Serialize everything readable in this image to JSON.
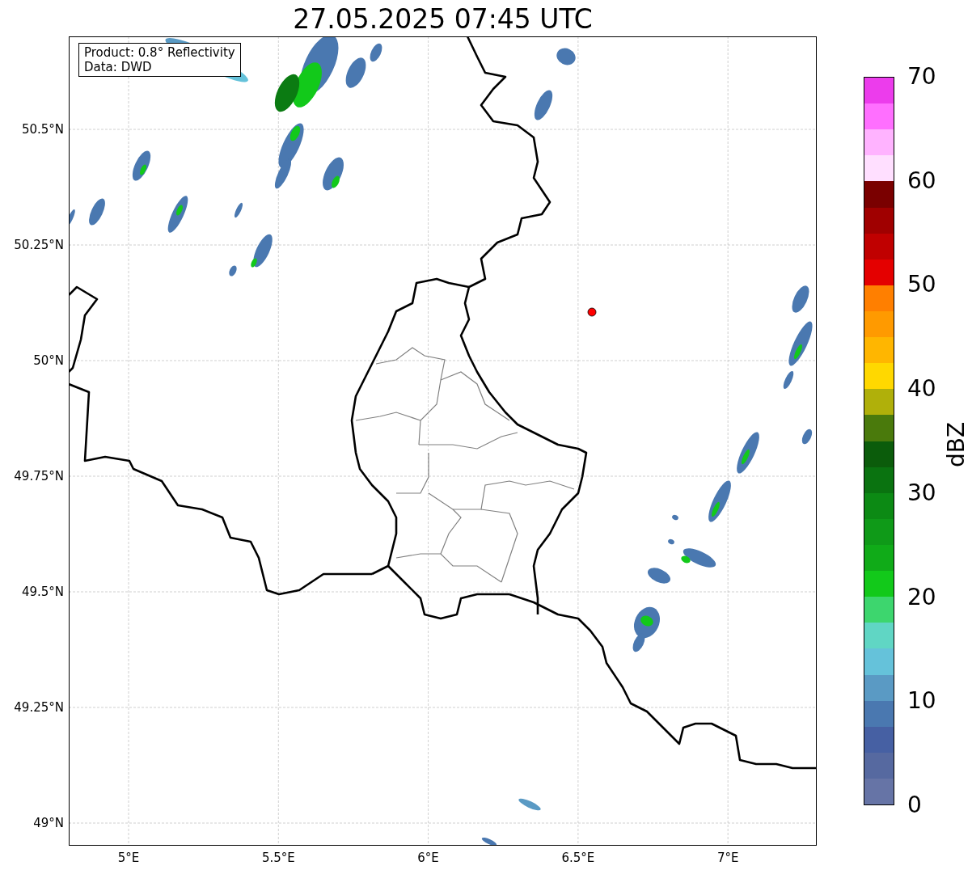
{
  "title": "27.05.2025 07:45 UTC",
  "info_box": [
    "Product: 0.8° Reflectivity",
    "Data: DWD"
  ],
  "map": {
    "y_ticks": [
      "50.5°N",
      "50.25°N",
      "50°N",
      "49.75°N",
      "49.5°N",
      "49.25°N",
      "49°N"
    ],
    "x_ticks": [
      "5°E",
      "5.5°E",
      "6°E",
      "6.5°E",
      "7°E"
    ]
  },
  "colorbar": {
    "label": "dBZ",
    "ticks": [
      "70",
      "60",
      "50",
      "40",
      "30",
      "20",
      "10",
      "0"
    ],
    "segments": [
      {
        "color": "#ec3cec"
      },
      {
        "color": "#ff6fff"
      },
      {
        "color": "#ffb3ff"
      },
      {
        "color": "#ffdfff"
      },
      {
        "color": "#7a0000"
      },
      {
        "color": "#a00000"
      },
      {
        "color": "#c00000"
      },
      {
        "color": "#e40000"
      },
      {
        "color": "#ff7f00"
      },
      {
        "color": "#ff9a00"
      },
      {
        "color": "#ffb600"
      },
      {
        "color": "#ffd800"
      },
      {
        "color": "#b0b00a"
      },
      {
        "color": "#4a7a0c"
      },
      {
        "color": "#0b5c0b"
      },
      {
        "color": "#0a7310"
      },
      {
        "color": "#0c8a14"
      },
      {
        "color": "#0f9a18"
      },
      {
        "color": "#10ab18"
      },
      {
        "color": "#12c91a"
      },
      {
        "color": "#3dd66e"
      },
      {
        "color": "#60d6c4"
      },
      {
        "color": "#65c2da"
      },
      {
        "color": "#5a9ac4"
      },
      {
        "color": "#4a78b0"
      },
      {
        "color": "#4660a3"
      },
      {
        "color": "#5669a0"
      },
      {
        "color": "#6674a6"
      }
    ]
  }
}
